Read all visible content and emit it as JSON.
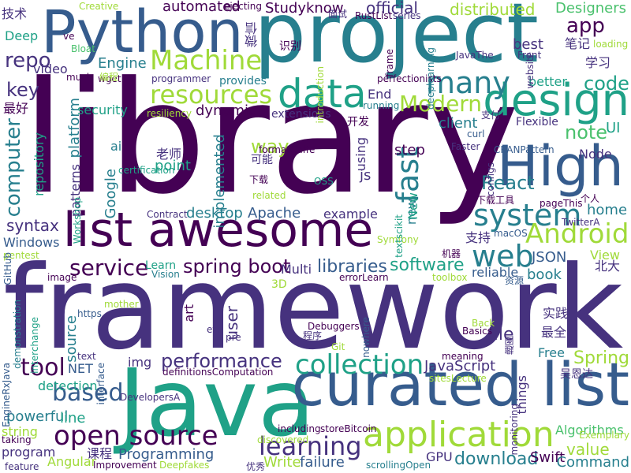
{
  "cloud": {
    "palette": [
      "#440154",
      "#46327e",
      "#365c8d",
      "#277f8e",
      "#1fa187",
      "#4ac16d",
      "#a0da39",
      "#fde725"
    ],
    "words": [
      {
        "text": "library",
        "c": 0
      },
      {
        "text": "framework",
        "c": 1
      },
      {
        "text": "project",
        "c": 3
      },
      {
        "text": "Java",
        "c": 4
      },
      {
        "text": "Python",
        "c": 2
      },
      {
        "text": "list awesome",
        "c": 0
      },
      {
        "text": "curated list",
        "c": 2
      },
      {
        "text": "High",
        "c": 2
      },
      {
        "text": "design",
        "c": 4
      },
      {
        "text": "application",
        "c": 6
      },
      {
        "text": "data",
        "c": 4
      },
      {
        "text": "Machine",
        "c": 6
      },
      {
        "text": "resources",
        "c": 6
      },
      {
        "text": "many",
        "c": 3
      },
      {
        "text": "web",
        "c": 3
      },
      {
        "text": "system",
        "c": 3
      },
      {
        "text": "Android",
        "c": 6
      },
      {
        "text": "collection",
        "c": 4
      },
      {
        "text": "open source",
        "c": 0
      },
      {
        "text": "learning",
        "c": 1
      },
      {
        "text": "tool",
        "c": 0
      },
      {
        "text": "based",
        "c": 2
      },
      {
        "text": "performance",
        "c": 1
      },
      {
        "text": "service",
        "c": 0
      },
      {
        "text": "spring boot",
        "c": 0
      },
      {
        "text": "libraries",
        "c": 2
      },
      {
        "text": "software",
        "c": 4
      },
      {
        "text": "Modern",
        "c": 6
      },
      {
        "text": "app",
        "c": 0
      },
      {
        "text": "code",
        "c": 4
      },
      {
        "text": "note",
        "c": 5
      },
      {
        "text": "UI",
        "c": 4
      },
      {
        "text": "fast",
        "c": 3
      },
      {
        "text": "computer",
        "c": 3
      },
      {
        "text": "repo",
        "c": 1
      },
      {
        "text": "key",
        "c": 1
      },
      {
        "text": "Spring",
        "c": 6
      },
      {
        "text": "JavaScript",
        "c": 1
      },
      {
        "text": "file",
        "c": 1
      },
      {
        "text": "Programming",
        "c": 2
      },
      {
        "text": "download",
        "c": 3
      },
      {
        "text": "Swift",
        "c": 0
      },
      {
        "text": "value",
        "c": 6
      },
      {
        "text": "Command",
        "c": 3
      },
      {
        "text": "distributed",
        "c": 6
      },
      {
        "text": "Designers",
        "c": 5
      },
      {
        "text": "automated",
        "c": 0
      },
      {
        "text": "Studyknow",
        "c": 0
      },
      {
        "text": "official",
        "c": 1
      },
      {
        "text": "React",
        "c": 3
      },
      {
        "text": "best",
        "c": 1
      },
      {
        "text": "Engine",
        "c": 3
      },
      {
        "text": "video",
        "c": 1
      },
      {
        "text": "platform",
        "c": 3
      },
      {
        "text": "dynamic",
        "c": 0
      },
      {
        "text": "security",
        "c": 4
      },
      {
        "text": "way",
        "c": 6
      },
      {
        "text": "point",
        "c": 4
      },
      {
        "text": "implemented",
        "c": 3
      },
      {
        "text": "patterns",
        "c": 1
      },
      {
        "text": "Google",
        "c": 3
      },
      {
        "text": "desktop",
        "c": 3
      },
      {
        "text": "Apache",
        "c": 2
      },
      {
        "text": "example",
        "c": 1
      },
      {
        "text": "home",
        "c": 3
      },
      {
        "text": "Node",
        "c": 1
      },
      {
        "text": "client",
        "c": 3
      },
      {
        "text": "step",
        "c": 0
      },
      {
        "text": "syntax",
        "c": 1
      },
      {
        "text": "Windows",
        "c": 2
      },
      {
        "text": "repository",
        "c": 4
      },
      {
        "text": "JSON",
        "c": 2
      },
      {
        "text": "book",
        "c": 3
      },
      {
        "text": "reliable",
        "c": 2
      },
      {
        "text": "View",
        "c": 6
      },
      {
        "text": "Free",
        "c": 3
      },
      {
        "text": "source",
        "c": 3
      },
      {
        "text": "detection",
        "c": 4
      },
      {
        "text": "powerful",
        "c": 3
      },
      {
        "text": "line",
        "c": 4
      },
      {
        "text": "string",
        "c": 6
      },
      {
        "text": "program",
        "c": 1
      },
      {
        "text": "failure",
        "c": 2
      },
      {
        "text": "GPU",
        "c": 1
      },
      {
        "text": "Algorithms",
        "c": 5
      },
      {
        "text": "Multi",
        "c": 1
      },
      {
        "text": "user",
        "c": 1
      },
      {
        "text": "art",
        "c": 0
      },
      {
        "text": "things",
        "c": 1
      },
      {
        "text": "img",
        "c": 1
      },
      {
        "text": "NET",
        "c": 2
      },
      {
        "text": "Write",
        "c": 6
      },
      {
        "text": "new",
        "c": 3
      },
      {
        "text": "New",
        "c": 4
      },
      {
        "text": "using",
        "c": 1
      },
      {
        "text": "End",
        "c": 1
      },
      {
        "text": "better",
        "c": 4
      },
      {
        "text": "js",
        "c": 1
      },
      {
        "text": "Flexible",
        "c": 1
      },
      {
        "text": "extensions",
        "c": 1
      },
      {
        "text": "formatCaffe",
        "c": 0
      },
      {
        "text": "Learn",
        "c": 4
      },
      {
        "text": "Vision",
        "c": 3
      },
      {
        "text": "Deep",
        "c": 4
      },
      {
        "text": "ai",
        "c": 3
      },
      {
        "text": "Debuggers",
        "c": 0
      },
      {
        "text": "Basics",
        "c": 0
      },
      {
        "text": "meaning",
        "c": 0
      },
      {
        "text": "Angular",
        "c": 6
      },
      {
        "text": "Improvement",
        "c": 0
      },
      {
        "text": "Deepfakes",
        "c": 6
      },
      {
        "text": "scrollingOpen",
        "c": 3
      },
      {
        "text": "including",
        "c": 0
      },
      {
        "text": "storeBitcoin",
        "c": 0
      },
      {
        "text": "discovered",
        "c": 6
      },
      {
        "text": "feature",
        "c": 1
      },
      {
        "text": "taking",
        "c": 0
      },
      {
        "text": "Exemplary",
        "c": 6
      },
      {
        "text": "monitoring",
        "c": 1
      },
      {
        "text": "errorLearn",
        "c": 0
      },
      {
        "text": "toolbox",
        "c": 6
      },
      {
        "text": "CRANPattern",
        "c": 2
      },
      {
        "text": "Faster",
        "c": 1
      },
      {
        "text": "curl",
        "c": 2
      },
      {
        "text": "macOS",
        "c": 2
      },
      {
        "text": "Symfony",
        "c": 6
      },
      {
        "text": "TwitterA",
        "c": 1
      },
      {
        "text": "pageThis",
        "c": 0
      },
      {
        "text": "OSS",
        "c": 4
      },
      {
        "text": "related",
        "c": 6
      },
      {
        "text": "Contract",
        "c": 1
      },
      {
        "text": "perfectionists",
        "c": 0
      },
      {
        "text": "provides",
        "c": 3
      },
      {
        "text": "programmer",
        "c": 1
      },
      {
        "text": "much",
        "c": 0
      },
      {
        "text": "Bloat",
        "c": 5
      },
      {
        "text": "wget",
        "c": 0
      },
      {
        "text": "ejecting",
        "c": 0
      },
      {
        "text": "Creative",
        "c": 6
      },
      {
        "text": "RustList",
        "c": 0
      },
      {
        "text": "series",
        "c": 1
      },
      {
        "text": "JavaThe",
        "c": 1
      },
      {
        "text": "loading",
        "c": 6
      },
      {
        "text": "Front",
        "c": 1
      },
      {
        "text": "running",
        "c": 3
      },
      {
        "text": "resiliency",
        "c": 6
      },
      {
        "text": "certification",
        "c": 4
      },
      {
        "text": "configs",
        "c": 1
      },
      {
        "text": "pentest",
        "c": 6
      },
      {
        "text": "Workshop",
        "c": 4
      },
      {
        "text": "mother",
        "c": 6
      },
      {
        "text": "https",
        "c": 2
      },
      {
        "text": "etc",
        "c": 1
      },
      {
        "text": "pre",
        "c": 1
      },
      {
        "text": "Git",
        "c": 6
      },
      {
        "text": "nowhere",
        "c": 2
      },
      {
        "text": "text",
        "c": 1
      },
      {
        "text": "definitionsComputation",
        "c": 0
      },
      {
        "text": "DevelopersA",
        "c": 1
      },
      {
        "text": "EngineRxJava",
        "c": 2
      },
      {
        "text": "demonstration",
        "c": 3
      },
      {
        "text": "interchange",
        "c": 4
      },
      {
        "text": "GitHub",
        "c": 2
      },
      {
        "text": "image",
        "c": 0
      },
      {
        "text": "interface",
        "c": 2
      },
      {
        "text": "sitesLecture",
        "c": 6
      },
      {
        "text": "Back",
        "c": 6
      },
      {
        "text": "website",
        "c": 1
      },
      {
        "text": "introduction",
        "c": 6
      },
      {
        "text": "deeplearning",
        "c": 3
      },
      {
        "text": "frame",
        "c": 0
      },
      {
        "text": "textscikit",
        "c": 4
      },
      {
        "text": "3D",
        "c": 6
      },
      {
        "text": "ve",
        "c": 0
      },
      {
        "text": "技术",
        "c": 1
      },
      {
        "text": "最好",
        "c": 0
      },
      {
        "text": "老师",
        "c": 1
      },
      {
        "text": "可能",
        "c": 1
      },
      {
        "text": "下载",
        "c": 0
      },
      {
        "text": "微信",
        "c": 1
      },
      {
        "text": "识别",
        "c": 0
      },
      {
        "text": "面试",
        "c": 1
      },
      {
        "text": "笔记",
        "c": 1
      },
      {
        "text": "学习",
        "c": 1
      },
      {
        "text": "开发",
        "c": 0
      },
      {
        "text": "支付",
        "c": 1
      },
      {
        "text": "下载工具",
        "c": 0
      },
      {
        "text": "个人",
        "c": 0
      },
      {
        "text": "支持",
        "c": 1
      },
      {
        "text": "机器",
        "c": 0
      },
      {
        "text": "北大",
        "c": 1
      },
      {
        "text": "资源",
        "c": 2
      },
      {
        "text": "实践",
        "c": 1
      },
      {
        "text": "最全",
        "c": 1
      },
      {
        "text": "趣图",
        "c": 1
      },
      {
        "text": "吴恩达",
        "c": 1
      },
      {
        "text": "课程",
        "c": 1
      },
      {
        "text": "程序",
        "c": 1
      },
      {
        "text": "优秀",
        "c": 1
      },
      {
        "text": "编程",
        "c": 6
      }
    ]
  }
}
